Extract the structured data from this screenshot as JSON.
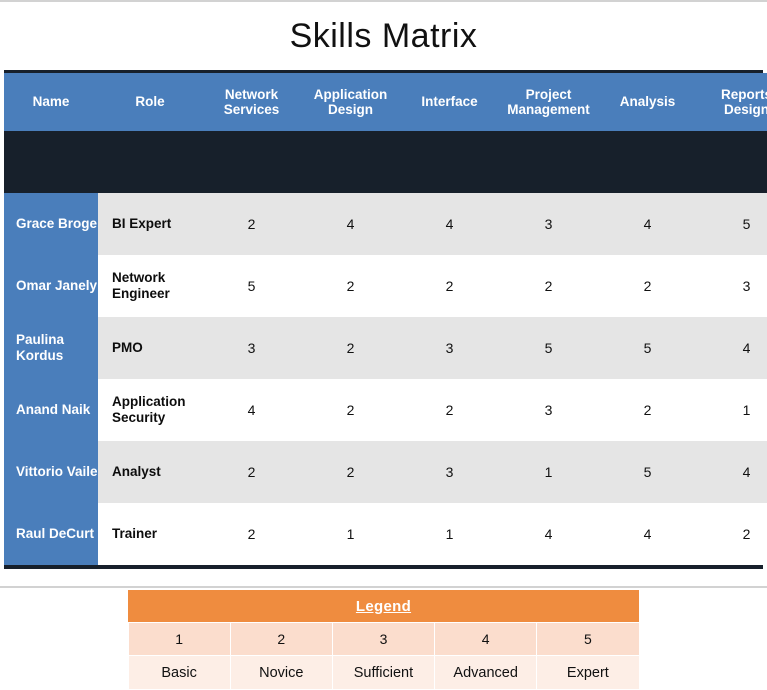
{
  "page_title": "Skills Matrix",
  "colors": {
    "header_blue": "#4a7ebb",
    "row_stripe": "#e5e5e5",
    "legend_orange": "#ef8c3f",
    "legend_num_bg": "#fbddcd",
    "legend_label_bg": "#fdeee6",
    "rule_dark": "#17202b"
  },
  "matrix": {
    "columns": [
      "Name",
      "Role",
      "Network Services",
      "Application Design",
      "Interface",
      "Project Management",
      "Analysis",
      "Reports Design"
    ],
    "rows": [
      {
        "name": "Grace Broge",
        "role": "BI Expert",
        "scores": [
          2,
          4,
          4,
          3,
          4,
          5
        ]
      },
      {
        "name": "Omar Janely",
        "role": "Network Engineer",
        "scores": [
          5,
          2,
          2,
          2,
          2,
          3
        ]
      },
      {
        "name": "Paulina Kordus",
        "role": "PMO",
        "scores": [
          3,
          2,
          3,
          5,
          5,
          4
        ]
      },
      {
        "name": "Anand Naik",
        "role": "Application Security",
        "scores": [
          4,
          2,
          2,
          3,
          2,
          1
        ]
      },
      {
        "name": "Vittorio Vaile",
        "role": "Analyst",
        "scores": [
          2,
          2,
          3,
          1,
          5,
          4
        ]
      },
      {
        "name": "Raul DeCurt",
        "role": "Trainer",
        "scores": [
          2,
          1,
          1,
          4,
          4,
          2
        ]
      }
    ]
  },
  "legend": {
    "title": "Legend",
    "levels": [
      {
        "value": "1",
        "label": "Basic"
      },
      {
        "value": "2",
        "label": "Novice"
      },
      {
        "value": "3",
        "label": "Sufficient"
      },
      {
        "value": "4",
        "label": "Advanced"
      },
      {
        "value": "5",
        "label": "Expert"
      }
    ]
  },
  "chart_data": {
    "type": "table",
    "title": "Skills Matrix",
    "categories": [
      "Network Services",
      "Application Design",
      "Interface",
      "Project Management",
      "Analysis",
      "Reports Design"
    ],
    "series": [
      {
        "name": "Grace Broge",
        "values": [
          2,
          4,
          4,
          3,
          4,
          5
        ]
      },
      {
        "name": "Omar Janely",
        "values": [
          5,
          2,
          2,
          2,
          2,
          3
        ]
      },
      {
        "name": "Paulina Kordus",
        "values": [
          3,
          2,
          3,
          5,
          5,
          4
        ]
      },
      {
        "name": "Anand Naik",
        "values": [
          4,
          2,
          2,
          3,
          2,
          1
        ]
      },
      {
        "name": "Vittorio Vaile",
        "values": [
          2,
          2,
          3,
          1,
          5,
          4
        ]
      },
      {
        "name": "Raul DeCurt",
        "values": [
          2,
          1,
          1,
          4,
          4,
          2
        ]
      }
    ],
    "value_scale": {
      "min": 1,
      "max": 5,
      "labels": [
        "Basic",
        "Novice",
        "Sufficient",
        "Advanced",
        "Expert"
      ]
    },
    "xlabel": "",
    "ylabel": "",
    "grid": true,
    "legend_position": "bottom"
  }
}
